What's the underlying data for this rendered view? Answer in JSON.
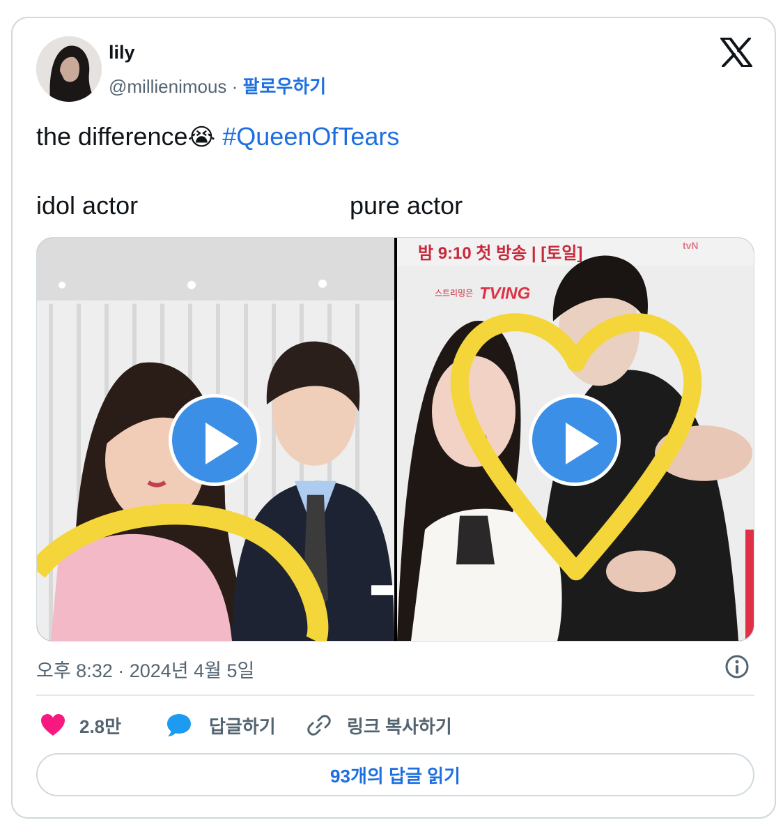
{
  "user": {
    "name": "lily",
    "handle": "@millienimous",
    "separator": "·",
    "follow_label": "팔로우하기"
  },
  "tweet": {
    "text": "the difference",
    "emoji": "😭",
    "hashtag": "#QueenOfTears",
    "left_label": "idol actor",
    "right_label": "pure actor"
  },
  "media": {
    "right_sign_top": "밤 9:10 첫 방송 | [토일]",
    "right_sign_streaming": "스트리밍은",
    "right_sign_brand": "TVING",
    "right_sign_tvn": "tvN",
    "heart_color": "#f4d63a",
    "play_color": "#3b8fe6"
  },
  "meta": {
    "timestamp": "오후 8:32 · 2024년 4월 5일"
  },
  "actions": {
    "like_count": "2.8만",
    "reply_label": "답글하기",
    "copy_link_label": "링크 복사하기",
    "like_color": "#f91880",
    "reply_color": "#1d9bf0"
  },
  "read_replies_label": "93개의 답글 읽기",
  "icons": {
    "logo": "x-logo-icon",
    "info": "info-icon",
    "like": "heart-icon",
    "reply": "speech-bubble-icon",
    "copy": "link-icon",
    "play": "play-icon"
  }
}
